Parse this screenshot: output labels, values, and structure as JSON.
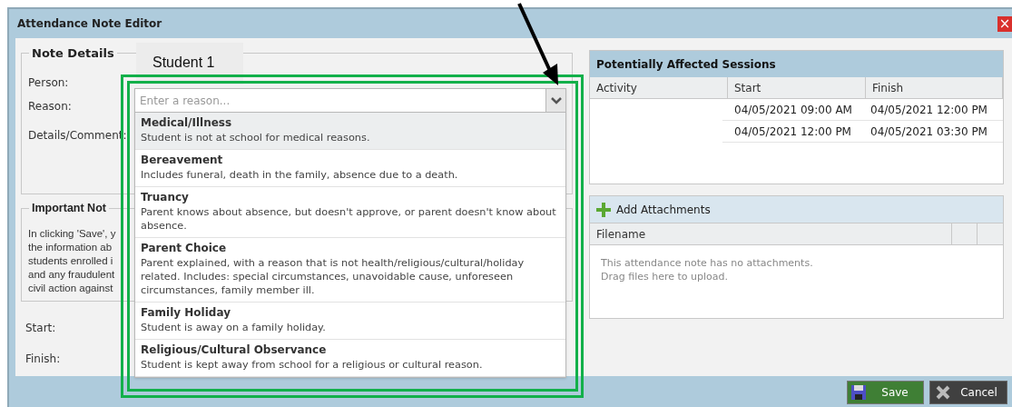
{
  "window": {
    "title": "Attendance Note Editor",
    "close": "×"
  },
  "student_label": "Student 1",
  "note_details": {
    "legend": "Note Details",
    "labels": [
      "Person:",
      "Reason:",
      "Details/Comment:"
    ]
  },
  "important_notice": {
    "legend": "Important Not",
    "lines": [
      "In clicking 'Save', y",
      "the information ab",
      "students enrolled i",
      "and any fraudulent",
      "civil action against"
    ]
  },
  "time_labels": [
    "Start:",
    "Finish:"
  ],
  "reason_dropdown": {
    "placeholder": "Enter a reason...",
    "options": [
      {
        "title": "Medical/Illness",
        "description": "Student is not at school for medical reasons.",
        "highlighted": true
      },
      {
        "title": "Bereavement",
        "description": "Includes funeral, death in the family, absence due to a death.",
        "highlighted": false
      },
      {
        "title": "Truancy",
        "description": "Parent knows about absence, but doesn't approve, or parent doesn't know about absence.",
        "highlighted": false
      },
      {
        "title": "Parent Choice",
        "description": "Parent explained, with a reason that is not health/religious/cultural/holiday related. Includes: special circumstances, unavoidable cause, unforeseen circumstances, family member ill.",
        "highlighted": false
      },
      {
        "title": "Family Holiday",
        "description": "Student is away on a family holiday.",
        "highlighted": false
      },
      {
        "title": "Religious/Cultural Observance",
        "description": "Student is kept away from school for a religious or cultural reason.",
        "highlighted": false
      }
    ]
  },
  "sessions": {
    "title": "Potentially Affected Sessions",
    "columns": [
      "Activity",
      "Start",
      "Finish"
    ],
    "rows": [
      {
        "start": "04/05/2021 09:00 AM",
        "finish": "04/05/2021 12:00 PM"
      },
      {
        "start": "04/05/2021 12:00 PM",
        "finish": "04/05/2021 03:30 PM"
      }
    ]
  },
  "attachments": {
    "add_button": "Add Attachments",
    "columns": [
      "Filename"
    ],
    "empty_lines": [
      "This attendance note has no attachments.",
      "Drag files here to upload."
    ]
  },
  "buttons": [
    {
      "kind": "save",
      "label": "Save"
    },
    {
      "kind": "cancel",
      "label": "Cancel"
    }
  ]
}
